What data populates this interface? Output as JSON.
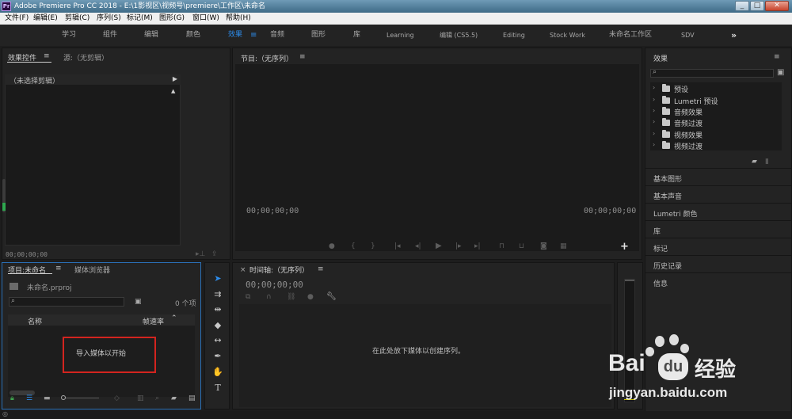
{
  "window": {
    "title": "Adobe Premiere Pro CC 2018 - E:\\1影视区\\视频号\\premiere\\工作区\\未命名",
    "logo_text": "Pr",
    "controls": [
      "_",
      "□",
      "✕"
    ]
  },
  "menu": {
    "items": [
      "文件(F)",
      "编辑(E)",
      "剪辑(C)",
      "序列(S)",
      "标记(M)",
      "图形(G)",
      "窗口(W)",
      "帮助(H)"
    ]
  },
  "workspaces": {
    "tabs": [
      "学习",
      "组件",
      "编辑",
      "颜色",
      "效果",
      "音频",
      "图形",
      "库",
      "Learning",
      "编辑 (CS5.5)",
      "Editing",
      "Stock Work",
      "未命名工作区",
      "SDV"
    ],
    "active": "效果",
    "more": "»"
  },
  "effect_controls": {
    "tab_label": "效果控件",
    "source_tab": "源:（无剪辑）",
    "no_clip": "（未选择剪辑）",
    "timecode": "00;00;00;00"
  },
  "program_monitor": {
    "title": "节目:（无序列）",
    "timecode_left": "00;00;00;00",
    "timecode_right": "00;00;00;00",
    "add_button": "+"
  },
  "effects_panel": {
    "title": "效果",
    "items": [
      "预设",
      "Lumetri 预设",
      "音频效果",
      "音频过渡",
      "视频效果",
      "视频过渡"
    ],
    "sections": [
      "基本图形",
      "基本声音",
      "Lumetri 颜色",
      "库",
      "标记",
      "历史记录",
      "信息"
    ]
  },
  "project": {
    "title": "项目:未命名",
    "browser_tab": "媒体浏览器",
    "filename": "未命名.prproj",
    "count": "0 个项",
    "col_name": "名称",
    "col_fps": "帧速率",
    "import_hint": "导入媒体以开始"
  },
  "timeline": {
    "title": "时间轴:（无序列）",
    "timecode": "00;00;00;00",
    "drop_hint": "在此处放下媒体以创建序列。",
    "close": "×"
  },
  "watermark": {
    "brand": "Bai",
    "brand2": "du",
    "cn": "经验",
    "url": "jingyan.baidu.com"
  },
  "colors": {
    "accent": "#2d8ceb",
    "highlight_box": "#d3241f",
    "panel_bg": "#232323"
  }
}
